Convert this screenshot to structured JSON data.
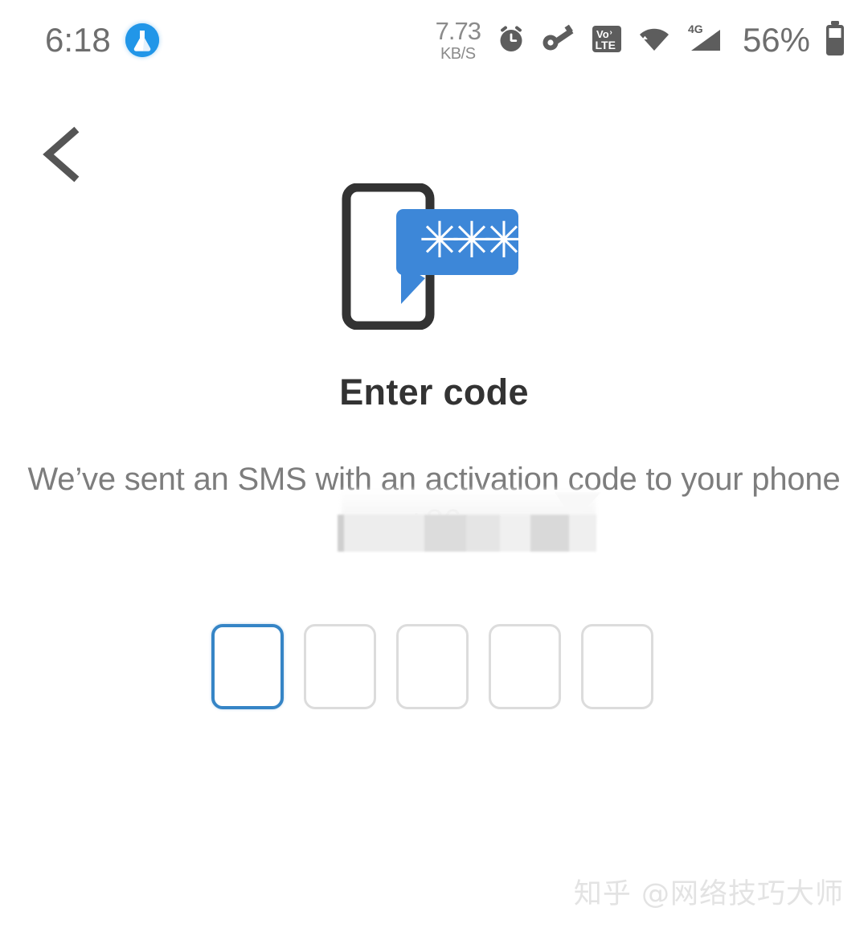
{
  "status_bar": {
    "time": "6:18",
    "app_icon": "flask-icon",
    "network_speed_value": "7.73",
    "network_speed_unit": "KB/S",
    "icons": [
      "alarm-icon",
      "vpn-key-icon",
      "volte-icon",
      "wifi-icon",
      "signal-4g-icon",
      "battery-icon"
    ],
    "volte_top": "Vo",
    "volte_bottom": "LTE",
    "signal_label": "4G",
    "battery_percent": "56%"
  },
  "nav": {
    "back_icon": "back-chevron-icon"
  },
  "illustration": {
    "name": "phone-sms-code-illustration",
    "bubble_text": "✳✳✳",
    "phone_color": "#333333",
    "bubble_color": "#3d87d8"
  },
  "content": {
    "title": "Enter code",
    "subtitle": "We’ve sent an SMS with an activation code to your phone",
    "phone_prefix": "+86",
    "phone_redacted": true
  },
  "code_input": {
    "boxes": [
      "",
      "",
      "",
      "",
      ""
    ],
    "focused_index": 0,
    "focus_color": "#3685c6",
    "idle_color": "#dcdcdc"
  },
  "watermark": {
    "text": "知乎 @网络技巧大师"
  }
}
